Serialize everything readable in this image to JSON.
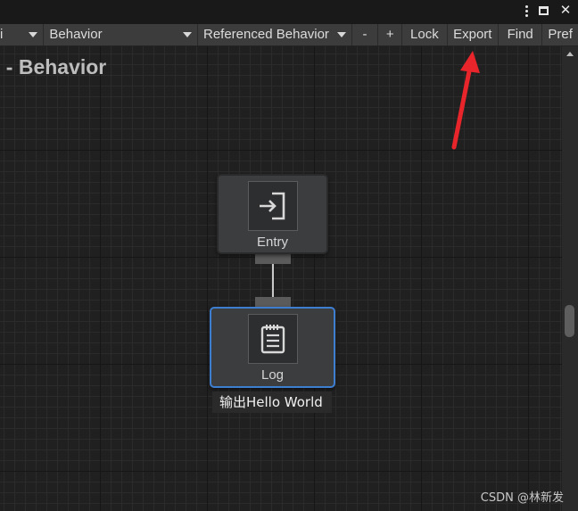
{
  "toolbar": {
    "first_label": "i",
    "behavior_label": "Behavior",
    "referenced_behavior_label": "Referenced Behavior",
    "minus_label": "-",
    "plus_label": "+",
    "lock_label": "Lock",
    "export_label": "Export",
    "find_label": "Find",
    "preferences_label": "Pref"
  },
  "window_icons": [
    "menu-dots-icon",
    "maximize-icon",
    "close-icon"
  ],
  "close_glyph": "✕",
  "graph": {
    "title": "j - Behavior",
    "nodes": [
      {
        "label": "Entry",
        "icon": "entry-icon"
      },
      {
        "label": "Log",
        "icon": "log-icon"
      }
    ],
    "comment": "输出Hello World"
  },
  "annotation_arrow_color": "#e8252b",
  "selection_color": "#3d7ed1",
  "watermark": "CSDN @林新发"
}
